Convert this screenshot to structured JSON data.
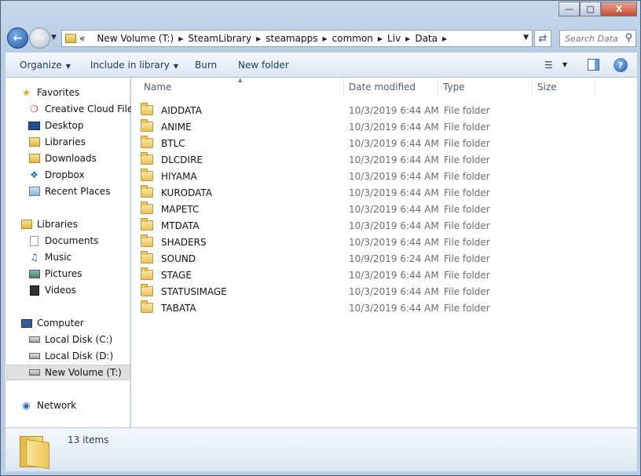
{
  "window": {
    "controls": {
      "minimize": "—",
      "maximize": "□",
      "close": "X"
    }
  },
  "nav": {
    "back_icon": "arrow-left-icon",
    "forward_icon": "arrow-right-icon",
    "breadcrumb": [
      "New Volume (T:)",
      "SteamLibrary",
      "steamapps",
      "common",
      "Liv",
      "Data"
    ],
    "overflow": "«",
    "search_placeholder": "Search Data"
  },
  "toolbar": {
    "organize": "Organize",
    "include_in_library": "Include in library",
    "burn": "Burn",
    "new_folder": "New folder"
  },
  "sidebar": {
    "favorites_header": "Favorites",
    "favorites": [
      "Creative Cloud Files",
      "Desktop",
      "Libraries",
      "Downloads",
      "Dropbox",
      "Recent Places"
    ],
    "libraries_header": "Libraries",
    "libraries": [
      "Documents",
      "Music",
      "Pictures",
      "Videos"
    ],
    "computer_header": "Computer",
    "computer": [
      "Local Disk (C:)",
      "Local Disk (D:)",
      "New Volume (T:)"
    ],
    "network": "Network",
    "selected": "New Volume (T:)"
  },
  "columns": {
    "name": "Name",
    "date": "Date modified",
    "type": "Type",
    "size": "Size"
  },
  "files": [
    {
      "name": "AIDDATA",
      "date": "10/3/2019 6:44 AM",
      "type": "File folder"
    },
    {
      "name": "ANIME",
      "date": "10/3/2019 6:44 AM",
      "type": "File folder"
    },
    {
      "name": "BTLC",
      "date": "10/3/2019 6:44 AM",
      "type": "File folder"
    },
    {
      "name": "DLCDIRE",
      "date": "10/3/2019 6:44 AM",
      "type": "File folder"
    },
    {
      "name": "HIYAMA",
      "date": "10/3/2019 6:44 AM",
      "type": "File folder"
    },
    {
      "name": "KURODATA",
      "date": "10/3/2019 6:44 AM",
      "type": "File folder"
    },
    {
      "name": "MAPETC",
      "date": "10/3/2019 6:44 AM",
      "type": "File folder"
    },
    {
      "name": "MTDATA",
      "date": "10/3/2019 6:44 AM",
      "type": "File folder"
    },
    {
      "name": "SHADERS",
      "date": "10/3/2019 6:44 AM",
      "type": "File folder"
    },
    {
      "name": "SOUND",
      "date": "10/9/2019 6:24 AM",
      "type": "File folder"
    },
    {
      "name": "STAGE",
      "date": "10/3/2019 6:44 AM",
      "type": "File folder"
    },
    {
      "name": "STATUSIMAGE",
      "date": "10/3/2019 6:44 AM",
      "type": "File folder"
    },
    {
      "name": "TABATA",
      "date": "10/3/2019 6:44 AM",
      "type": "File folder"
    }
  ],
  "status": {
    "item_count": "13 items"
  }
}
